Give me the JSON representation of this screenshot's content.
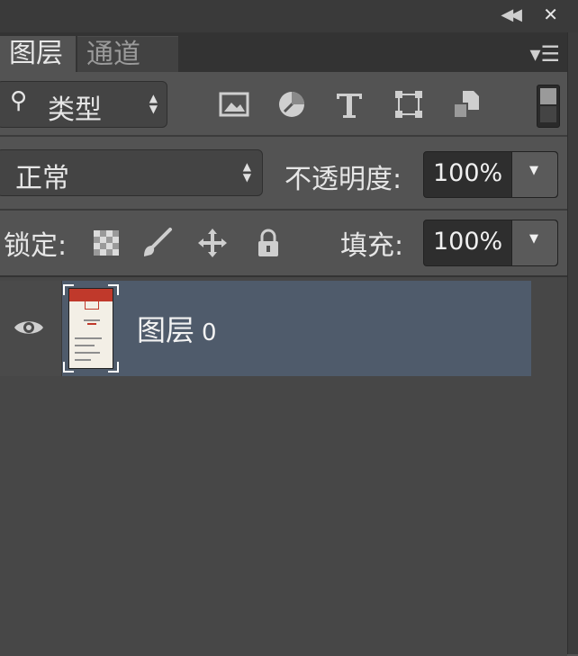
{
  "window": {
    "collapse_icon": "double-chevron-left-icon",
    "close_icon": "close-icon"
  },
  "tabs": [
    {
      "label": "图层",
      "active": true
    },
    {
      "label": "通道",
      "active": false
    }
  ],
  "panel_menu_icon": "panel-menu-icon",
  "filter": {
    "icon": "search-icon",
    "label": "类型",
    "icons": [
      "image-filter-icon",
      "adjustment-filter-icon",
      "type-filter-icon",
      "shape-filter-icon",
      "smart-object-filter-icon"
    ]
  },
  "blend": {
    "mode": "正常",
    "opacity_label": "不透明度:",
    "opacity_value": "100%"
  },
  "lock": {
    "label": "锁定:",
    "icons": [
      "lock-transparent-icon",
      "lock-image-icon",
      "lock-position-icon",
      "lock-all-icon"
    ],
    "fill_label": "填充:",
    "fill_value": "100%"
  },
  "layers": [
    {
      "name": "图层",
      "index": "0",
      "visible": true,
      "selected": true
    }
  ],
  "colors": {
    "panel_bg": "#535353",
    "selected_row": "#4f5b6b",
    "tab_bar": "#333333"
  }
}
